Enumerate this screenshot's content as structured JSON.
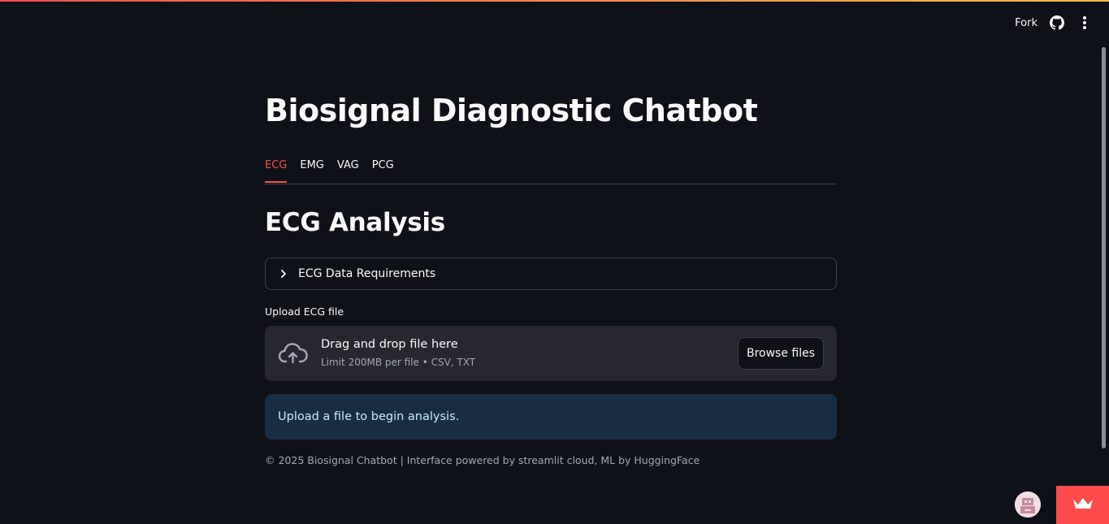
{
  "header": {
    "fork_label": "Fork",
    "github_icon": "github-icon",
    "menu_icon": "kebab-menu-icon"
  },
  "colors": {
    "background": "#0e1117",
    "accent": "#ff4b4b",
    "info_background": "#172d43",
    "info_text": "#c7ebff",
    "dropzone_background": "#262730"
  },
  "main": {
    "title": "Biosignal Diagnostic Chatbot",
    "tabs": [
      {
        "label": "ECG",
        "active": true
      },
      {
        "label": "EMG",
        "active": false
      },
      {
        "label": "VAG",
        "active": false
      },
      {
        "label": "PCG",
        "active": false
      }
    ],
    "section_title": "ECG Analysis",
    "expander": {
      "label": "ECG Data Requirements",
      "icon": "chevron-right-icon",
      "expanded": false
    },
    "uploader": {
      "label": "Upload ECG file",
      "icon": "cloud-upload-icon",
      "dropzone_title": "Drag and drop file here",
      "dropzone_subtitle": "Limit 200MB per file • CSV, TXT",
      "browse_label": "Browse files"
    },
    "info_message": "Upload a file to begin analysis.",
    "footer": "© 2025 Biosignal Chatbot | Interface powered by streamlit cloud, ML by HuggingFace"
  },
  "corner": {
    "avatar_icon": "user-avatar-icon",
    "badge_icon": "crown-icon"
  }
}
